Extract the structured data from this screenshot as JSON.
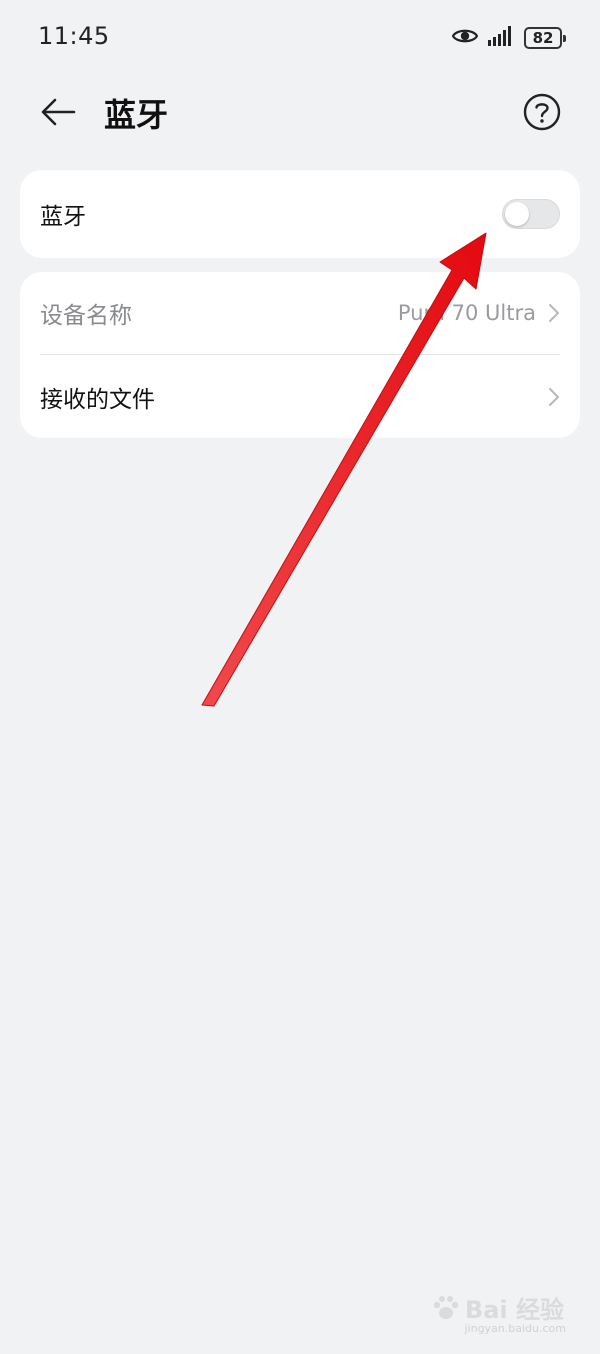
{
  "status_bar": {
    "time": "11:45",
    "battery": "82"
  },
  "header": {
    "title": "蓝牙"
  },
  "bluetooth": {
    "label": "蓝牙",
    "enabled": false
  },
  "device": {
    "name_label": "设备名称",
    "name_value": "Pura 70 Ultra",
    "received_files_label": "接收的文件"
  },
  "watermark": {
    "text": "Bai 经验",
    "sub": "jingyan.baidu.com"
  },
  "colors": {
    "arrow": "#e8161b",
    "background": "#f1f2f4"
  },
  "icons": [
    "eye-icon",
    "signal-icon",
    "battery-icon",
    "back-arrow-icon",
    "help-icon",
    "chevron-right-icon",
    "paw-icon"
  ]
}
